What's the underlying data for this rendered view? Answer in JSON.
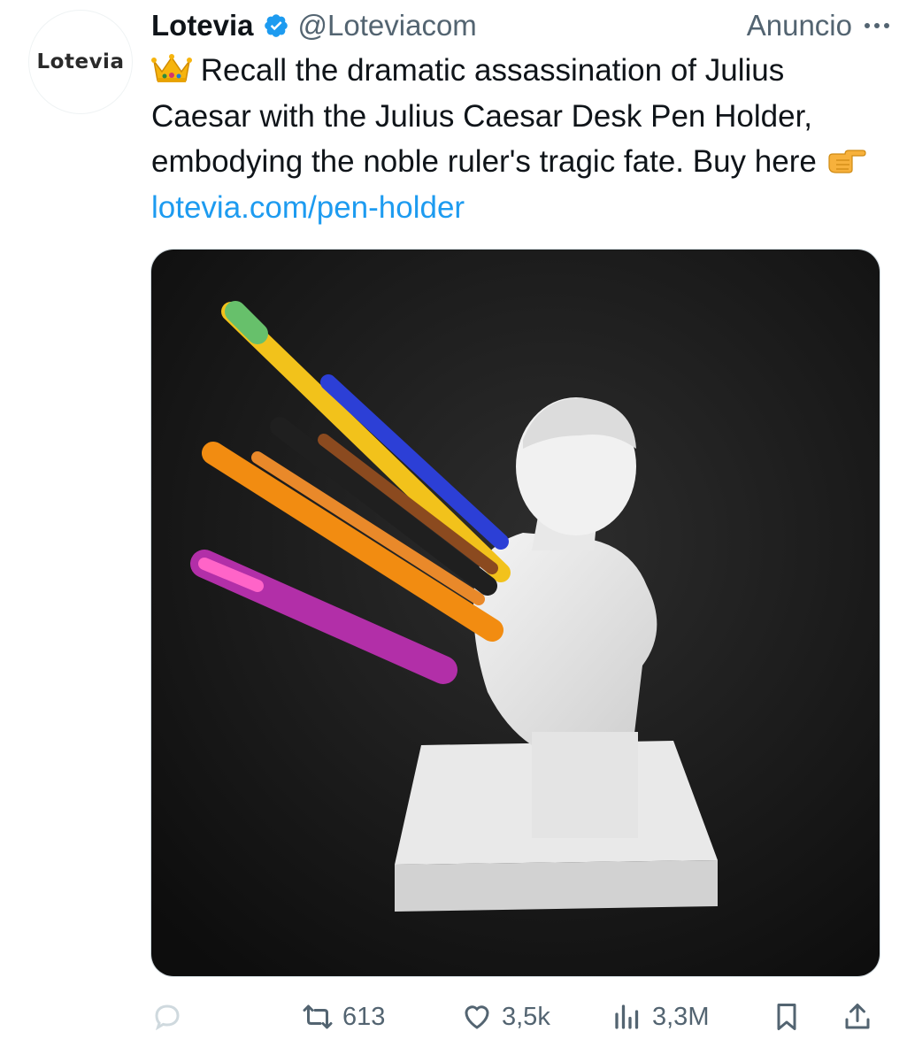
{
  "post": {
    "avatar_text": "Lotevia",
    "author_name": "Lotevia",
    "handle": "@Loteviacom",
    "ad_label": "Anuncio",
    "text_main": "Recall the dramatic assassination of Julius Caesar with the Julius Caesar Desk Pen Holder, embodying the noble ruler's tragic fate. Buy here",
    "link": "lotevia.com/pen-holder",
    "emoji_lead": "crown-icon",
    "emoji_point": "pointing-hand-icon",
    "media_description_icon": "bust-image",
    "colors": {
      "link": "#1d9bf0",
      "secondary": "#536471",
      "verified": "#1d9bf0"
    }
  },
  "actions": {
    "reply_count": "",
    "retweet_count": "613",
    "like_count": "3,5k",
    "views_count": "3,3M"
  }
}
